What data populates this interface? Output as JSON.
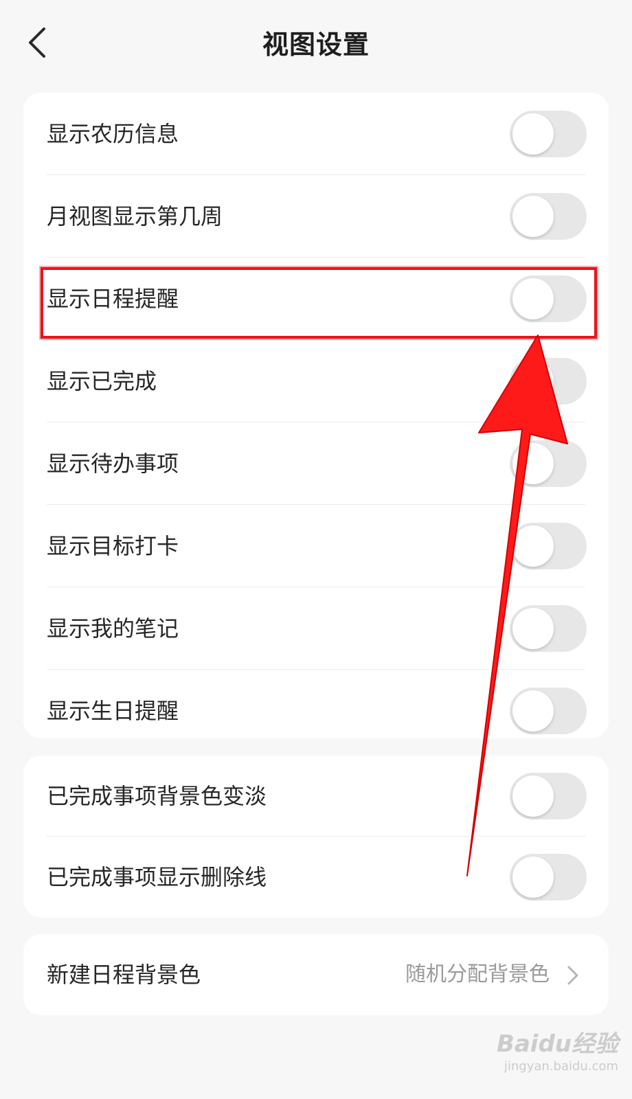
{
  "header": {
    "title": "视图设置",
    "back_icon": "chevron-left-icon"
  },
  "group1": {
    "items": [
      {
        "label": "显示农历信息",
        "toggle_on": false
      },
      {
        "label": "月视图显示第几周",
        "toggle_on": false
      },
      {
        "label": "显示日程提醒",
        "toggle_on": false
      },
      {
        "label": "显示已完成",
        "toggle_on": false
      },
      {
        "label": "显示待办事项",
        "toggle_on": false
      },
      {
        "label": "显示目标打卡",
        "toggle_on": false
      },
      {
        "label": "显示我的笔记",
        "toggle_on": false
      },
      {
        "label": "显示生日提醒",
        "toggle_on": false
      }
    ]
  },
  "group2": {
    "items": [
      {
        "label": "已完成事项背景色变淡",
        "toggle_on": false
      },
      {
        "label": "已完成事项显示删除线",
        "toggle_on": false
      }
    ]
  },
  "group3": {
    "label": "新建日程背景色",
    "value": "随机分配背景色",
    "chevron_icon": "chevron-right-icon"
  },
  "annotation": {
    "highlight_color": "#e8141b",
    "highlighted_item": "显示日程提醒"
  },
  "watermark": {
    "logo": "Baidu经验",
    "url": "jingyan.baidu.com"
  },
  "colors": {
    "background": "#f7f7f7",
    "card": "#ffffff",
    "toggle_off": "#e7e7e7",
    "arrow": "#ff1a1a"
  }
}
